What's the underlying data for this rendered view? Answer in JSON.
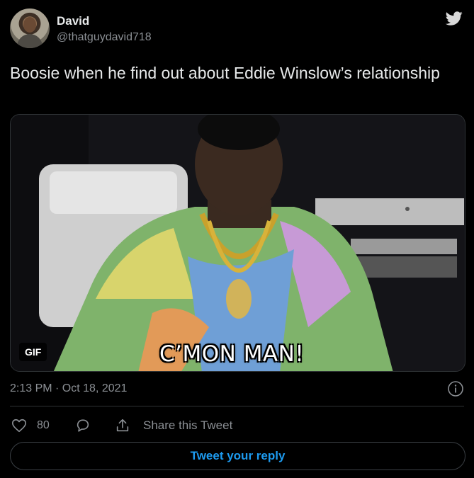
{
  "tweet": {
    "author": {
      "name": "David",
      "handle": "@thatguydavid718"
    },
    "text": "Boosie when he find out about Eddie Winslow’s relationship",
    "media": {
      "badge": "GIF",
      "caption": "C’MON MAN!"
    },
    "timestamp": "2:13 PM · Oct 18, 2021",
    "likes": "80",
    "share_label": "Share this Tweet",
    "reply_button_label": "Tweet your reply"
  },
  "icons": {
    "brand": "twitter-bird",
    "info": "info-circle",
    "like": "heart-outline",
    "reply": "speech-bubble",
    "share": "upload-arrow"
  },
  "colors": {
    "background": "#000000",
    "primary_text": "#e7e9ea",
    "secondary_text": "#8b8f94",
    "accent": "#1d9bf0",
    "border": "#2f3336"
  }
}
